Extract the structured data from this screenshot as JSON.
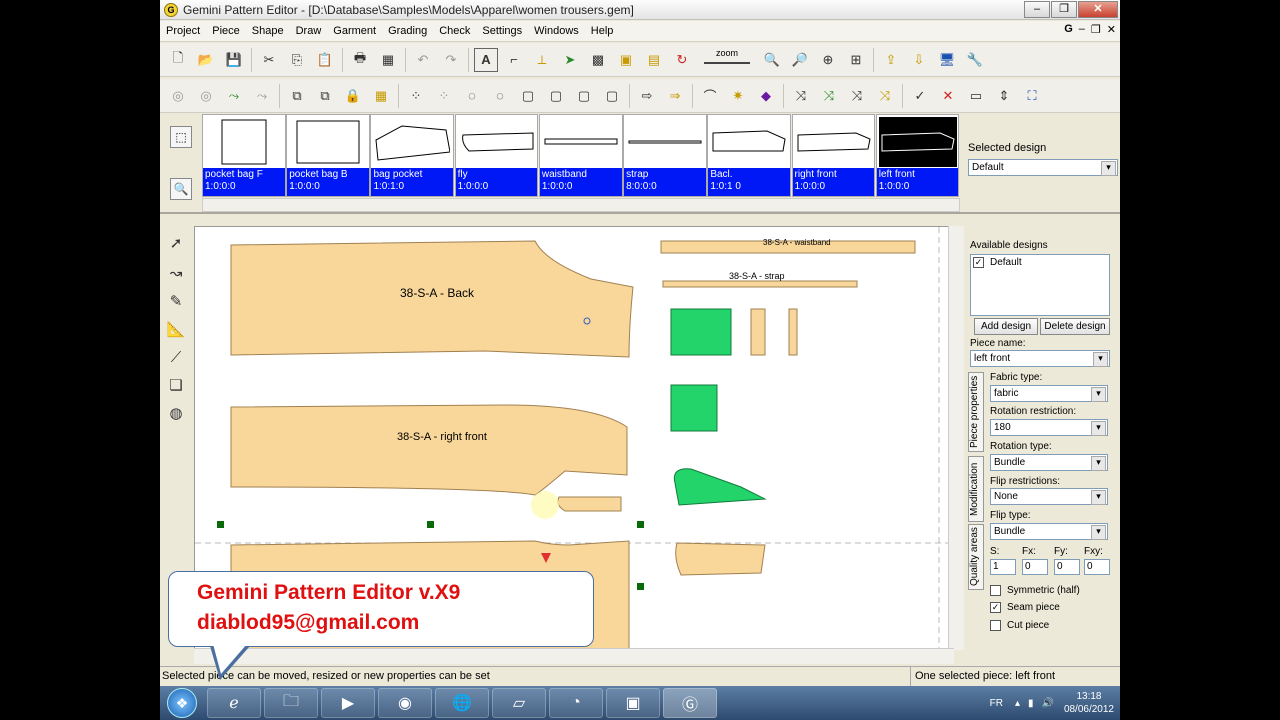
{
  "window": {
    "title": "Gemini Pattern Editor - [D:\\Database\\Samples\\Models\\Apparel\\women trousers.gem]",
    "app_icon_letter": "G",
    "minimize": "–",
    "maximize": "❐",
    "close": "✕"
  },
  "menu": {
    "items": [
      "Project",
      "Piece",
      "Shape",
      "Draw",
      "Garment",
      "Grading",
      "Check",
      "Settings",
      "Windows",
      "Help"
    ],
    "mdi_icon": "G",
    "mdi_min": "–",
    "mdi_max": "❐",
    "mdi_close": "✕"
  },
  "toolbar": {
    "zoom_label": "zoom"
  },
  "pieces": [
    {
      "name": "pocket bag F",
      "code": "1:0:0:0"
    },
    {
      "name": "pocket bag B",
      "code": "1:0:0:0"
    },
    {
      "name": "bag pocket",
      "code": "1:0:1:0"
    },
    {
      "name": "fly",
      "code": "1:0:0:0"
    },
    {
      "name": "waistband",
      "code": "1:0:0:0"
    },
    {
      "name": "strap",
      "code": "8:0:0:0"
    },
    {
      "name": "Bacl.",
      "code": "1:0:1 0"
    },
    {
      "name": "right front",
      "code": "1:0:0:0"
    },
    {
      "name": "left front",
      "code": "1:0:0:0"
    }
  ],
  "selected_design": {
    "label": "Selected design",
    "value": "Default"
  },
  "canvas": {
    "back_label": "38-S-A - Back",
    "right_front_label": "38-S-A - right front",
    "waistband_label": "38-S-A - waistband",
    "strap_label": "38-S-A - strap"
  },
  "right_panel": {
    "available_designs_label": "Available designs",
    "designs": [
      "Default"
    ],
    "add_design": "Add design",
    "delete_design": "Delete design",
    "piece_name_label": "Piece name:",
    "piece_name": "left front",
    "tabs": [
      "Piece properties",
      "Modification",
      "Quality areas"
    ],
    "fabric_type_label": "Fabric type:",
    "fabric_type": "fabric",
    "rotation_restriction_label": "Rotation restriction:",
    "rotation_restriction": "180",
    "rotation_type_label": "Rotation type:",
    "rotation_type": "Bundle",
    "flip_restrictions_label": "Flip restrictions:",
    "flip_restrictions": "None",
    "flip_type_label": "Flip type:",
    "flip_type": "Bundle",
    "s_label": "S:",
    "s_value": "1",
    "fx_label": "Fx:",
    "fx_value": "0",
    "fy_label": "Fy:",
    "fy_value": "0",
    "fxy_label": "Fxy:",
    "fxy_value": "0",
    "symmetric_label": "Symmetric (half)",
    "seam_piece_label": "Seam piece",
    "cut_piece_label": "Cut piece"
  },
  "status": {
    "left": "Selected piece can be moved, resized or new properties can be set",
    "right": "One selected piece: left front"
  },
  "callout": {
    "line1": "Gemini Pattern Editor v.X9",
    "line2": "diablod95@gmail.com"
  },
  "taskbar": {
    "lang": "FR",
    "time": "13:18",
    "date": "08/06/2012"
  },
  "colors": {
    "piece_fill": "#f9d79a",
    "piece_green": "#22d46a",
    "thumb_label_bg": "#0018f5",
    "callout_text": "#e01010"
  }
}
